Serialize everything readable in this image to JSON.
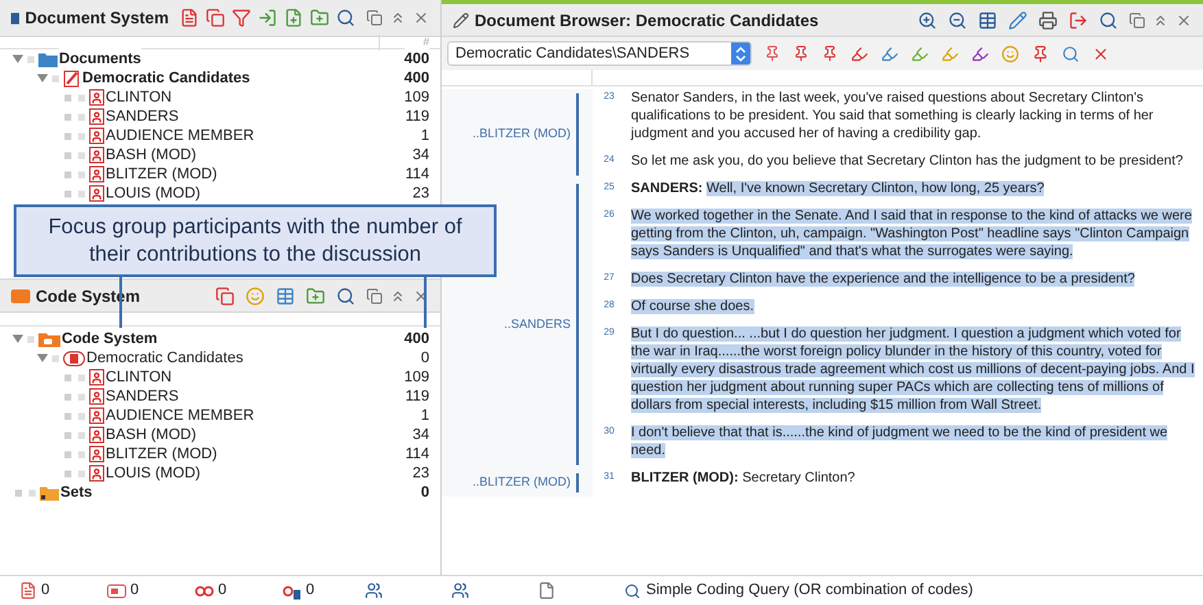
{
  "document_system": {
    "title": "Document System",
    "count_header": "#",
    "tree": [
      {
        "kind": "folder",
        "label": "Documents",
        "count": "400",
        "expanded": true,
        "children": [
          {
            "kind": "document_group",
            "label": "Democratic Candidates",
            "count": "400",
            "expanded": true,
            "children": [
              {
                "kind": "document",
                "label": "CLINTON",
                "count": "109"
              },
              {
                "kind": "document",
                "label": "SANDERS",
                "count": "119"
              },
              {
                "kind": "document",
                "label": "AUDIENCE MEMBER",
                "count": "1"
              },
              {
                "kind": "document",
                "label": "BASH (MOD)",
                "count": "34"
              },
              {
                "kind": "document",
                "label": "BLITZER (MOD)",
                "count": "114"
              },
              {
                "kind": "document",
                "label": "LOUIS (MOD)",
                "count": "23"
              }
            ]
          }
        ]
      }
    ]
  },
  "code_system": {
    "title": "Code System",
    "tree": [
      {
        "kind": "code_root",
        "label": "Code System",
        "count": "400",
        "expanded": true,
        "children": [
          {
            "kind": "code_group",
            "label": "Democratic Candidates",
            "count": "0",
            "expanded": true,
            "children": [
              {
                "kind": "code",
                "label": "CLINTON",
                "count": "109"
              },
              {
                "kind": "code",
                "label": "SANDERS",
                "count": "119"
              },
              {
                "kind": "code",
                "label": "AUDIENCE MEMBER",
                "count": "1"
              },
              {
                "kind": "code",
                "label": "BASH (MOD)",
                "count": "34"
              },
              {
                "kind": "code",
                "label": "BLITZER (MOD)",
                "count": "114"
              },
              {
                "kind": "code",
                "label": "LOUIS (MOD)",
                "count": "23"
              }
            ]
          }
        ]
      },
      {
        "kind": "set",
        "label": "Sets",
        "count": "0"
      }
    ]
  },
  "callout": {
    "text": "Focus group participants with the number of their contributions to the discussion"
  },
  "document_browser": {
    "title": "Document Browser: Democratic Candidates",
    "path": "Democratic Candidates\\SANDERS",
    "segments": [
      {
        "code": "..BLITZER (MOD)",
        "paragraphs": [
          {
            "number": "23",
            "selected": false,
            "text": "Senator Sanders, in the last week, you've raised questions about Secretary Clinton's qualifications to be president. You said that something is clearly lacking in terms of her judgment and you accused her of having a credibility gap."
          },
          {
            "number": "24",
            "selected": false,
            "text": "So let me ask you, do you believe that Secretary Clinton has the judgment to be president?"
          }
        ]
      },
      {
        "code": "..SANDERS",
        "paragraphs": [
          {
            "number": "25",
            "selected": true,
            "speaker": "SANDERS:",
            "text": "Well, I've known Secretary Clinton, how long, 25 years?"
          },
          {
            "number": "26",
            "selected": true,
            "text": "We worked together in the Senate. And I said that in response to the kind of attacks we were getting from the Clinton, uh, campaign. \"Washington Post\" headline says \"Clinton Campaign says Sanders is Unqualified\" and that's what the surrogates were saying."
          },
          {
            "number": "27",
            "selected": true,
            "text": "Does Secretary Clinton have the experience and the intelligence to be a president?"
          },
          {
            "number": "28",
            "selected": true,
            "text": "Of course she does."
          },
          {
            "number": "29",
            "selected": true,
            "text": "But I do question... ...but I do question her judgment. I question a judgment which voted for the war in Iraq......the worst foreign policy blunder in the history of this country, voted for virtually every disastrous trade agreement which cost us millions of decent-paying jobs. And I question her judgment about running super PACs which are collecting tens of millions of dollars from special interests, including $15 million from Wall Street."
          },
          {
            "number": "30",
            "selected": true,
            "text": "I don't believe that that is......the kind of judgment we need to be the kind of president we need."
          }
        ]
      },
      {
        "code": "..BLITZER (MOD)",
        "paragraphs": [
          {
            "number": "31",
            "selected": false,
            "speaker": "BLITZER (MOD):",
            "text": "Secretary Clinton?"
          }
        ]
      }
    ]
  },
  "status_bar": {
    "counters": [
      {
        "kind": "documents",
        "value": "0"
      },
      {
        "kind": "memos",
        "value": "0"
      },
      {
        "kind": "codes",
        "value": "0"
      },
      {
        "kind": "variables",
        "value": "0"
      }
    ],
    "query": "Simple Coding Query (OR combination of codes)"
  }
}
